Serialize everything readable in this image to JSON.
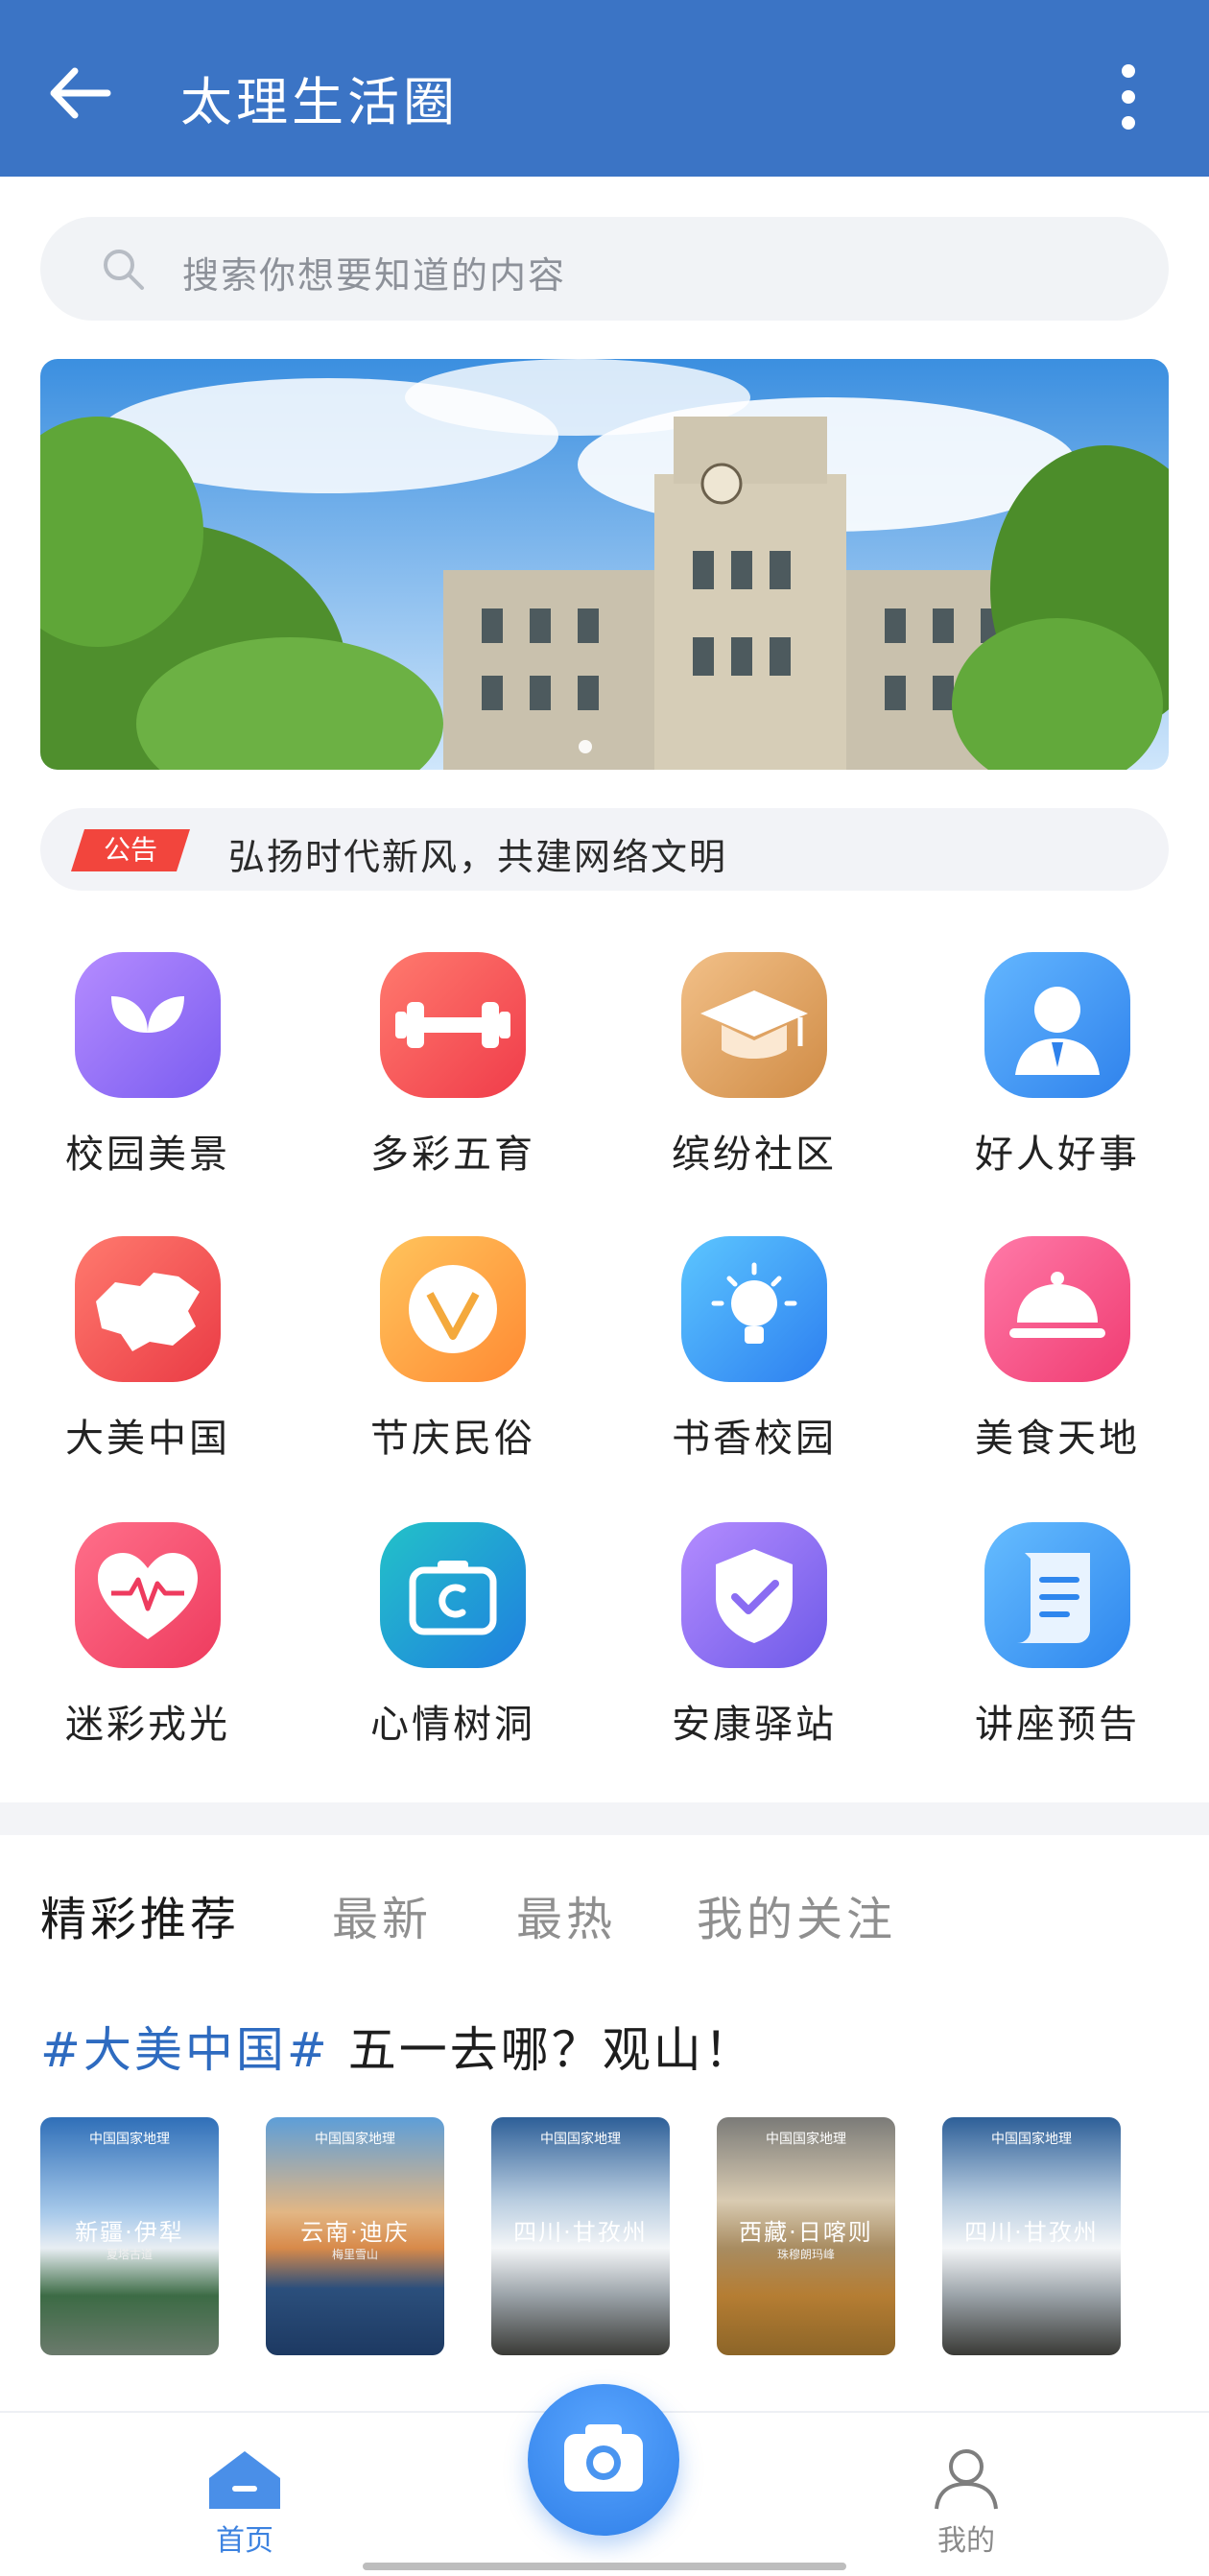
{
  "app_bar": {
    "title": "太理生活圈"
  },
  "search": {
    "placeholder": "搜索你想要知道的内容"
  },
  "notice": {
    "tag": "公告",
    "text": "弘扬时代新风，共建网络文明"
  },
  "grid": [
    {
      "label": "校园美景",
      "icon": "sprout-icon"
    },
    {
      "label": "多彩五育",
      "icon": "dumbbell-icon"
    },
    {
      "label": "缤纷社区",
      "icon": "graduation-cap-icon"
    },
    {
      "label": "好人好事",
      "icon": "person-icon"
    },
    {
      "label": "大美中国",
      "icon": "china-map-icon"
    },
    {
      "label": "节庆民俗",
      "icon": "festival-icon"
    },
    {
      "label": "书香校园",
      "icon": "lightbulb-icon"
    },
    {
      "label": "美食天地",
      "icon": "food-cloche-icon"
    },
    {
      "label": "迷彩戎光",
      "icon": "heartbeat-icon"
    },
    {
      "label": "心情树洞",
      "icon": "camera-icon"
    },
    {
      "label": "安康驿站",
      "icon": "shield-check-icon"
    },
    {
      "label": "讲座预告",
      "icon": "scroll-icon"
    }
  ],
  "tabs": [
    {
      "label": "精彩推荐",
      "active": true
    },
    {
      "label": "最新",
      "active": false
    },
    {
      "label": "最热",
      "active": false
    },
    {
      "label": "我的关注",
      "active": false
    }
  ],
  "topic": {
    "hashtag": "#大美中国#",
    "text": "五一去哪？观山！"
  },
  "cards": [
    {
      "header": "中国国家地理",
      "place": "新疆·伊犁",
      "sub": "夏塔古道"
    },
    {
      "header": "中国国家地理",
      "place": "云南·迪庆",
      "sub": "梅里雪山"
    },
    {
      "header": "中国国家地理",
      "place": "四川·甘孜州",
      "sub": ""
    },
    {
      "header": "中国国家地理",
      "place": "西藏·日喀则",
      "sub": "珠穆朗玛峰"
    },
    {
      "header": "中国国家地理",
      "place": "四川·甘孜州",
      "sub": ""
    }
  ],
  "bottom_nav": {
    "home": "首页",
    "me": "我的"
  }
}
